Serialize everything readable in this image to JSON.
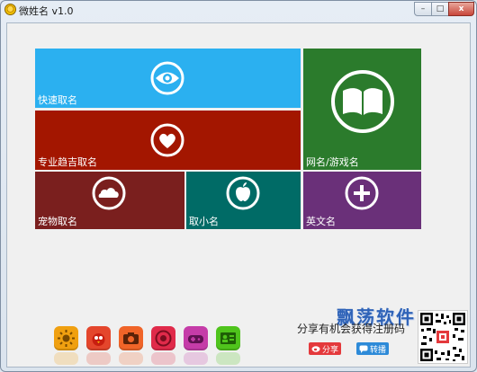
{
  "window": {
    "title": "微姓名 v1.0",
    "controls": {
      "minimize": "–",
      "maximize": "□",
      "close": "x"
    }
  },
  "tiles": [
    {
      "id": "quick",
      "label": "快速取名",
      "icon": "eye-icon",
      "color": "#2bb0f0"
    },
    {
      "id": "pro",
      "label": "专业趋吉取名",
      "icon": "heart-icon",
      "color": "#a31600"
    },
    {
      "id": "net",
      "label": "网名/游戏名",
      "icon": "book-icon",
      "color": "#2b7b2c"
    },
    {
      "id": "pet",
      "label": "宠物取名",
      "icon": "cloud-icon",
      "color": "#7a1f1e"
    },
    {
      "id": "nick",
      "label": "取小名",
      "icon": "apple-icon",
      "color": "#006b66"
    },
    {
      "id": "eng",
      "label": "英文名",
      "icon": "plus-icon",
      "color": "#6a3079"
    }
  ],
  "dock": [
    {
      "name": "sun-app-icon",
      "color": "#f0a010"
    },
    {
      "name": "bird-app-icon",
      "color": "#e4462c"
    },
    {
      "name": "camera-app-icon",
      "color": "#f06428"
    },
    {
      "name": "chrome-app-icon",
      "color": "#e02a4a"
    },
    {
      "name": "gamepad-app-icon",
      "color": "#c53ca8"
    },
    {
      "name": "contacts-app-icon",
      "color": "#4fc41c"
    }
  ],
  "promo": {
    "text": "分享有机会获得注册码",
    "watermark": "飘荡软件",
    "share_label": "分享",
    "repost_label": "转播"
  }
}
